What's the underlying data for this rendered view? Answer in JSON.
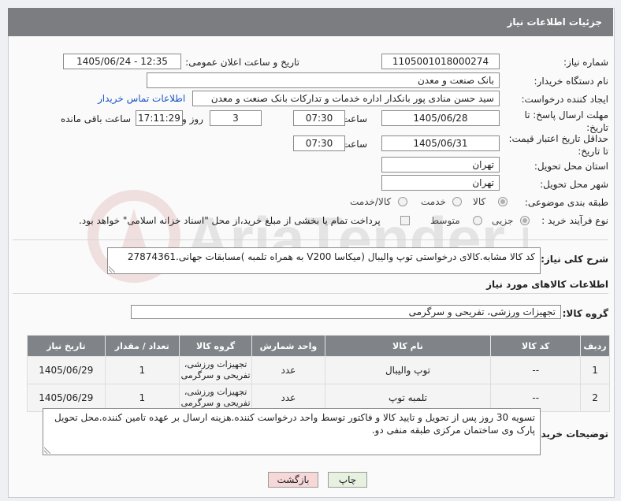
{
  "header": {
    "title": "جزئیات اطلاعات نیاز"
  },
  "fields": {
    "need_number_label": "شماره نیاز:",
    "need_number": "1105001018000274",
    "announce_label": "تاریخ و ساعت اعلان عمومی:",
    "announce_value": "1405/06/24 - 12:35",
    "buyer_label": "نام دستگاه خریدار:",
    "buyer_value": "بانک صنعت و معدن",
    "creator_label": "ایجاد کننده درخواست:",
    "creator_value": "سید حسن منادی پور بانکدار اداره خدمات و تدارکات بانک صنعت و معدن",
    "contact_link": "اطلاعات تماس خریدار",
    "deadline_label_1": "مهلت ارسال پاسخ: تا",
    "deadline_label_2": "تاریخ:",
    "deadline_date": "1405/06/28",
    "time_label": "ساعت",
    "deadline_time": "07:30",
    "days_value": "3",
    "days_label": "روز و",
    "remaining_time": "17:11:29",
    "remaining_label": "ساعت باقی مانده",
    "validity_label_1": "حداقل تاریخ اعتبار قیمت:",
    "validity_label_2": "تا تاریخ:",
    "validity_date": "1405/06/31",
    "validity_time": "07:30",
    "province_label": "استان محل تحویل:",
    "province_value": "تهران",
    "city_label": "شهر محل تحویل:",
    "city_value": "تهران",
    "category_label": "طبقه بندی موضوعی:",
    "category_options": [
      "کالا",
      "خدمت",
      "کالا/خدمت"
    ],
    "process_label": "نوع فرآیند خرید :",
    "process_options": [
      "جزیی",
      "متوسط"
    ],
    "payment_note": "پرداخت تمام یا بخشی از مبلغ خرید،از محل \"اسناد خزانه اسلامی\" خواهد بود."
  },
  "description": {
    "label": "شرح کلی نیاز:",
    "value": "کد کالا مشابه.کالای درخواستی توپ والیبال (میکاسا V200 به همراه تلمبه )مسابقات جهانی.27874361"
  },
  "goods_info": {
    "title": "اطلاعات کالاهای مورد نیاز"
  },
  "goods_group": {
    "label": "گروه کالا:",
    "value": "تجهیزات ورزشی، تفریحی و سرگرمی"
  },
  "table": {
    "headers": [
      "ردیف",
      "کد کالا",
      "نام کالا",
      "واحد شمارش",
      "گروه کالا",
      "تعداد / مقدار",
      "تاریخ نیاز"
    ],
    "rows": [
      [
        "1",
        "--",
        "توپ والیبال",
        "عدد",
        "تجهیزات ورزشی، تفریحی و سرگرمی",
        "1",
        "1405/06/29"
      ],
      [
        "2",
        "--",
        "تلمبه توپ",
        "عدد",
        "تجهیزات ورزشی، تفریحی و سرگرمی",
        "1",
        "1405/06/29"
      ]
    ]
  },
  "buyer_notes": {
    "label": "توضیحات خریدار:",
    "value": "تسویه 30 روز پس از تحویل و تایید کالا و فاکتور توسط واحد درخواست کننده.هزینه ارسال بر عهده  تامین کننده.محل تحویل پارک وی ساختمان مرکزی طبقه منفی دو."
  },
  "buttons": {
    "print": "چاپ",
    "back": "بازگشت"
  },
  "watermark": {
    "text": "AriaTender.net"
  },
  "colors": {
    "header_bg": "#7b7d80",
    "link": "#1a56c9",
    "back_button_bg": "#f6d8d8",
    "print_button_bg": "#e6f2df"
  }
}
